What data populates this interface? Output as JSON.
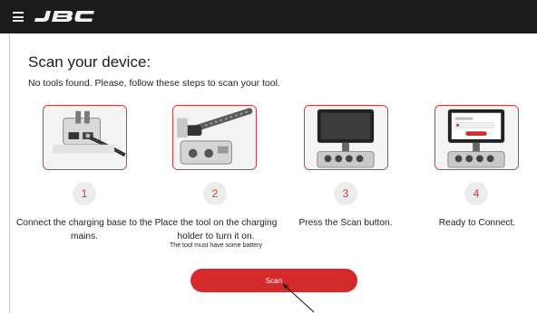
{
  "header": {
    "menu_icon": "hamburger-menu-icon",
    "logo_text": "JBC",
    "background": "#1c1c1c"
  },
  "page": {
    "title": "Scan your device:",
    "subtitle": "No tools found. Please, follow these steps to scan your tool."
  },
  "steps": [
    {
      "number": "1",
      "label": "Connect the charging base to the mains.",
      "image": "charging-base-mains-illustration"
    },
    {
      "number": "2",
      "label": "Place the tool on the charging holder to turn it on.",
      "note": "The tool must have some battery",
      "image": "tool-on-holder-illustration"
    },
    {
      "number": "3",
      "label": "Press the Scan button.",
      "image": "tablet-scan-illustration"
    },
    {
      "number": "4",
      "label": "Ready to Connect.",
      "image": "tablet-ready-illustration"
    }
  ],
  "scan_button": {
    "label": "Scan"
  },
  "colors": {
    "accent": "#d42a2a",
    "step_circle": "#ececec",
    "text": "#222222"
  }
}
